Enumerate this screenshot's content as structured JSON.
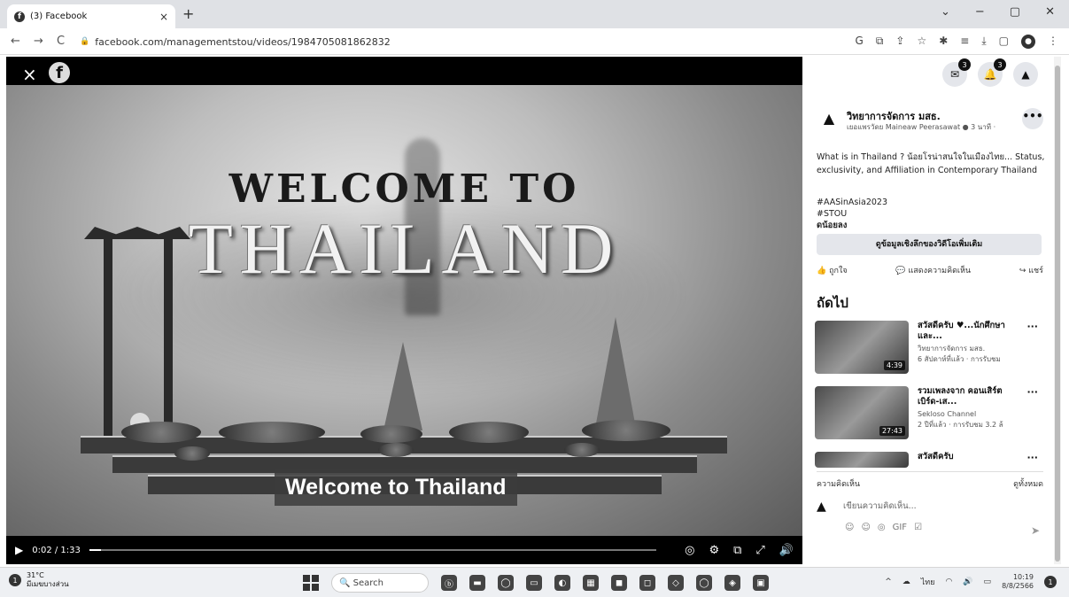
{
  "browser": {
    "tab_title": "(3) Facebook",
    "tab_close": "×",
    "new_tab": "+",
    "window_controls": [
      "⌄",
      "−",
      "▢",
      "✕"
    ],
    "url": "facebook.com/managementstou/videos/1984705081862832",
    "nav": {
      "back": "←",
      "forward": "→",
      "reload": "C"
    },
    "toolbar_icons": [
      "G",
      "⧉",
      "⇪",
      "☆",
      "✱",
      "≡",
      "⤓",
      "▢"
    ]
  },
  "video": {
    "close": "×",
    "logo": "f",
    "title_line1": "WELCOME TO",
    "title_line2": "THAILAND",
    "subtitle": "Welcome to Thailand",
    "time": "0:02 / 1:33",
    "progress_percent": 2,
    "play": "▶",
    "controls": [
      "◎",
      "⚙",
      "⧉",
      "⤢",
      "🔊"
    ]
  },
  "panel": {
    "top_icons": [
      {
        "name": "messenger-icon",
        "glyph": "✉",
        "badge": "3"
      },
      {
        "name": "notifications-icon",
        "glyph": "🔔",
        "badge": "3"
      },
      {
        "name": "profile-icon",
        "glyph": "▲",
        "badge": ""
      }
    ],
    "post": {
      "author": "วิทยาการจัดการ มสธ.",
      "meta": "เยอแพรวัดย Maineaw Peerasawat ● 3 นาที ·",
      "more": "•••",
      "body": "What is in Thailand ? น้อยโรน่าสนใจในเมืองไทย... Status, exclusivity, and Affiliation in Contemporary Thailand",
      "tags": [
        "#AASinAsia2023",
        "#STOU"
      ],
      "see_less": "ดน้อยลง",
      "insights_button": "ดูข้อมูลเชิงลึกของวิดีโอเพิ่มเติม",
      "actions": [
        "ถูกใจ",
        "แสดงความคิดเห็น",
        "แชร์"
      ]
    },
    "next_heading": "ถัดไป",
    "videos": [
      {
        "title": "สวัสดีครับ ♥...นักศึกษาและ...",
        "channel": "วิทยาการจัดการ มสธ.",
        "meta": "6 สัปดาห์ที่แล้ว · การรับชม",
        "duration": "4:39",
        "more": "···"
      },
      {
        "title": "รวมเพลงจาก คอนเสิร์ต เบิร์ด-เส...",
        "channel": "Sekloso Channel",
        "meta": "2 ปีที่แล้ว · การรับชม 3.2 ล้",
        "duration": "27:43",
        "more": "···"
      },
      {
        "title": "สวัสดีครับ",
        "channel": "",
        "meta": "",
        "duration": "",
        "more": "···"
      }
    ],
    "comments_label": "ความคิดเห็น",
    "see_all": "ดูทั้งหมด",
    "comment_placeholder": "เขียนความคิดเห็น...",
    "comment_tools": [
      "☺",
      "☺",
      "◎",
      "GIF",
      "☑"
    ],
    "send": "➤"
  },
  "taskbar": {
    "temp": "31°C",
    "weather_desc": "มีเมฆบางส่วน",
    "weather_badge": "1",
    "search": "Search",
    "apps": [
      "ⓑ",
      "▬",
      "◯",
      "▭",
      "◐",
      "▦",
      "◼",
      "◻",
      "◇",
      "◯",
      "◈",
      "▣"
    ],
    "tray": [
      "^",
      "☁",
      "ไทย",
      "◠",
      "🔊",
      "▭"
    ],
    "time": "10:19",
    "date": "8/8/2566",
    "notif": "1"
  }
}
